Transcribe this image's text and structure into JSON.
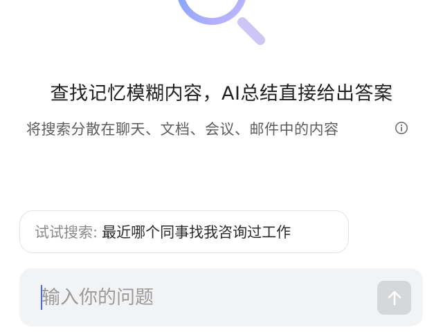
{
  "hero": {
    "icon": "search-magnifier-icon",
    "colors": {
      "ring_start": "#7fa8ff",
      "ring_end": "#c8b8ff",
      "handle": "#cdc6f5"
    }
  },
  "headline": "查找记忆模糊内容，AI总结直接给出答案",
  "subline": "将搜索分散在聊天、文档、会议、邮件中的内容",
  "info_icon": "info-circle-icon",
  "suggestion": {
    "prefix": "试试搜索:",
    "query": "最近哪个同事找我咨询过工作"
  },
  "composer": {
    "placeholder": "输入你的问题",
    "value": "",
    "send_icon": "arrow-up-icon",
    "colors": {
      "caret": "#3d6bff",
      "send_bg": "#d6d7d9",
      "box_bg": "#f2f3f5"
    }
  }
}
